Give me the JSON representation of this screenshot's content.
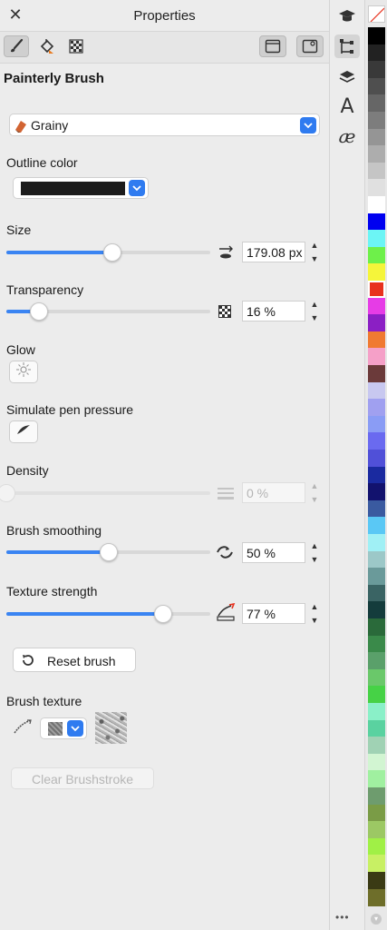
{
  "window": {
    "title": "Properties"
  },
  "brush": {
    "name": "Painterly Brush",
    "preset": "Grainy"
  },
  "outline": {
    "label": "Outline color",
    "color": "#1c1c1c"
  },
  "size": {
    "label": "Size",
    "value": "179.08 px",
    "level": 0.52
  },
  "transparency": {
    "label": "Transparency",
    "value": "16 %",
    "level": 0.16
  },
  "glow": {
    "label": "Glow"
  },
  "pressure": {
    "label": "Simulate pen pressure"
  },
  "density": {
    "label": "Density",
    "value": "0 %",
    "level": 0.0
  },
  "smoothing": {
    "label": "Brush smoothing",
    "value": "50 %",
    "level": 0.5
  },
  "texture_strength": {
    "label": "Texture strength",
    "value": "77 %",
    "level": 0.77
  },
  "reset": {
    "label": "Reset brush"
  },
  "texture": {
    "label": "Brush texture"
  },
  "clear": {
    "label": "Clear Brushstroke"
  },
  "sidebar": {
    "more": "•••"
  },
  "colors": {
    "accent": "#3a84f2",
    "palette": [
      "#000000",
      "#222222",
      "#393939",
      "#4f4f4f",
      "#666666",
      "#7d7d7d",
      "#959595",
      "#adadad",
      "#c5c5c5",
      "#e0e0e0",
      "#ffffff",
      "#0000f0",
      "#6cf5f5",
      "#6ef04a",
      "#f5f53a",
      "#e8321e",
      "#e63ce6",
      "#8b1fc4",
      "#f07a32",
      "#f5a0c8",
      "#6b3a3a",
      "#c8c8f0",
      "#a0a0f0",
      "#8a9cf5",
      "#6a6af0",
      "#5050d8",
      "#1a2aa0",
      "#12126e",
      "#3a5aa0",
      "#5ac8f5",
      "#a0f0f5",
      "#9cc8c8",
      "#6a9a9a",
      "#3a6464",
      "#143c3c",
      "#2a6a3a",
      "#3a8a4a",
      "#5aa06a",
      "#6ac86a",
      "#46d246",
      "#8af0c8",
      "#5ad2a0",
      "#a0d2b4",
      "#d2f5d2",
      "#a0f0a0",
      "#6e9c6e",
      "#7a9c46",
      "#9cc864",
      "#a0f046",
      "#c8f064",
      "#3a3a14",
      "#6e6e2a"
    ]
  }
}
